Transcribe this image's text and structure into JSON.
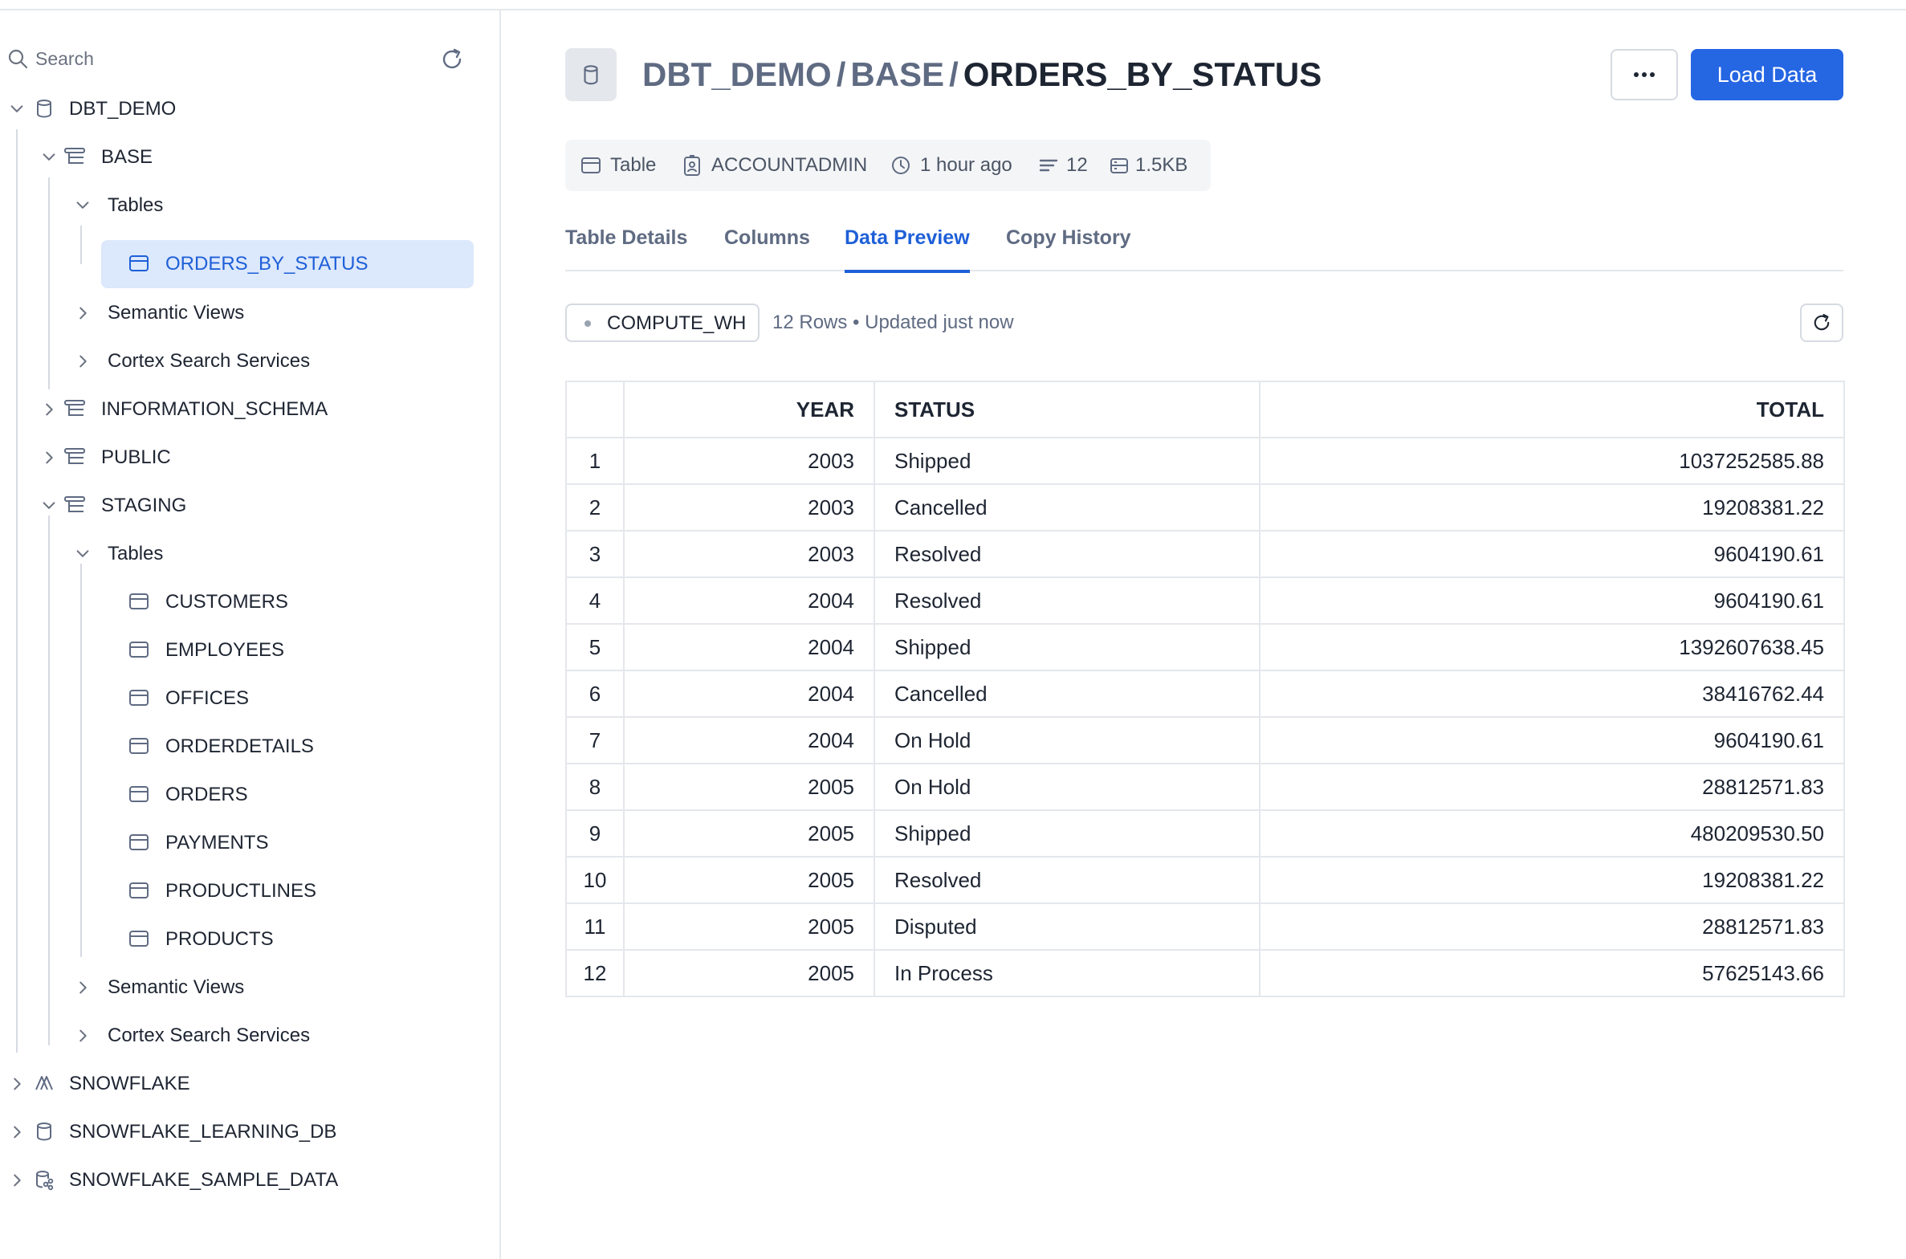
{
  "sidebar": {
    "search_placeholder": "Search",
    "tree": [
      {
        "label": "DBT_DEMO",
        "icon": "database-icon",
        "expanded": true
      },
      {
        "label": "BASE",
        "icon": "schema-icon",
        "expanded": true
      },
      {
        "label": "Tables",
        "expanded": true
      },
      {
        "label": "ORDERS_BY_STATUS",
        "icon": "table-icon",
        "selected": true
      },
      {
        "label": "Semantic Views",
        "expanded": false
      },
      {
        "label": "Cortex Search Services",
        "expanded": false
      },
      {
        "label": "INFORMATION_SCHEMA",
        "icon": "schema-icon",
        "expanded": false
      },
      {
        "label": "PUBLIC",
        "icon": "schema-icon",
        "expanded": false
      },
      {
        "label": "STAGING",
        "icon": "schema-icon",
        "expanded": true
      },
      {
        "label": "Tables",
        "expanded": true
      },
      {
        "label": "CUSTOMERS",
        "icon": "table-icon"
      },
      {
        "label": "EMPLOYEES",
        "icon": "table-icon"
      },
      {
        "label": "OFFICES",
        "icon": "table-icon"
      },
      {
        "label": "ORDERDETAILS",
        "icon": "table-icon"
      },
      {
        "label": "ORDERS",
        "icon": "table-icon"
      },
      {
        "label": "PAYMENTS",
        "icon": "table-icon"
      },
      {
        "label": "PRODUCTLINES",
        "icon": "table-icon"
      },
      {
        "label": "PRODUCTS",
        "icon": "table-icon"
      },
      {
        "label": "Semantic Views",
        "expanded": false
      },
      {
        "label": "Cortex Search Services",
        "expanded": false
      },
      {
        "label": "SNOWFLAKE",
        "icon": "snowflake-app-icon",
        "expanded": false
      },
      {
        "label": "SNOWFLAKE_LEARNING_DB",
        "icon": "database-icon",
        "expanded": false
      },
      {
        "label": "SNOWFLAKE_SAMPLE_DATA",
        "icon": "shared-database-icon",
        "expanded": false
      }
    ]
  },
  "header": {
    "breadcrumb": [
      "DBT_DEMO",
      "BASE"
    ],
    "separator": "/",
    "title": "ORDERS_BY_STATUS",
    "more_label": "…",
    "load_label": "Load Data",
    "accent": "#2566e3"
  },
  "meta": {
    "type": "Table",
    "owner": "ACCOUNTADMIN",
    "updated": "1 hour ago",
    "rows": "12",
    "size": "1.5KB"
  },
  "tabs": [
    {
      "label": "Table Details",
      "active": false
    },
    {
      "label": "Columns",
      "active": false
    },
    {
      "label": "Data Preview",
      "active": true
    },
    {
      "label": "Copy History",
      "active": false
    }
  ],
  "preview": {
    "warehouse": "COMPUTE_WH",
    "status": "12 Rows • Updated just now",
    "columns": [
      "YEAR",
      "STATUS",
      "TOTAL"
    ],
    "rows": [
      [
        "1",
        "2003",
        "Shipped",
        "1037252585.88"
      ],
      [
        "2",
        "2003",
        "Cancelled",
        "19208381.22"
      ],
      [
        "3",
        "2003",
        "Resolved",
        "9604190.61"
      ],
      [
        "4",
        "2004",
        "Resolved",
        "9604190.61"
      ],
      [
        "5",
        "2004",
        "Shipped",
        "1392607638.45"
      ],
      [
        "6",
        "2004",
        "Cancelled",
        "38416762.44"
      ],
      [
        "7",
        "2004",
        "On Hold",
        "9604190.61"
      ],
      [
        "8",
        "2005",
        "On Hold",
        "28812571.83"
      ],
      [
        "9",
        "2005",
        "Shipped",
        "480209530.50"
      ],
      [
        "10",
        "2005",
        "Resolved",
        "19208381.22"
      ],
      [
        "11",
        "2005",
        "Disputed",
        "28812571.83"
      ],
      [
        "12",
        "2005",
        "In Process",
        "57625143.66"
      ]
    ]
  }
}
